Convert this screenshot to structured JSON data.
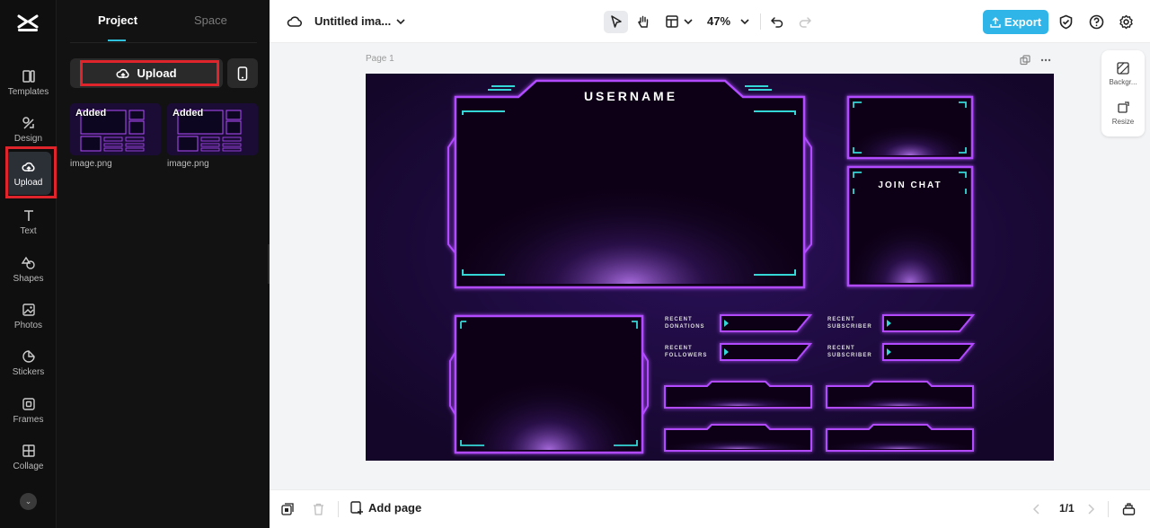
{
  "rail": {
    "items": [
      {
        "label": "Templates",
        "icon": "templates-icon"
      },
      {
        "label": "Design",
        "icon": "design-icon"
      },
      {
        "label": "Upload",
        "icon": "upload-cloud-icon",
        "active": true
      },
      {
        "label": "Text",
        "icon": "text-icon"
      },
      {
        "label": "Shapes",
        "icon": "shapes-icon"
      },
      {
        "label": "Photos",
        "icon": "photos-icon"
      },
      {
        "label": "Stickers",
        "icon": "stickers-icon"
      },
      {
        "label": "Frames",
        "icon": "frames-icon"
      },
      {
        "label": "Collage",
        "icon": "collage-icon"
      }
    ]
  },
  "panel": {
    "tabs": [
      {
        "label": "Project"
      },
      {
        "label": "Space"
      }
    ],
    "upload_label": "Upload",
    "assets": [
      {
        "badge": "Added",
        "name": "image.png"
      },
      {
        "badge": "Added",
        "name": "image.png"
      }
    ]
  },
  "topbar": {
    "title": "Untitled ima...",
    "zoom": "47%",
    "export_label": "Export"
  },
  "canvas": {
    "page_label": "Page 1",
    "overlay": {
      "username": "USERNAME",
      "join_chat": "JOIN CHAT",
      "recent_donations": [
        "RECENT",
        "DONATIONS"
      ],
      "recent_followers": [
        "RECENT",
        "FOLLOWERS"
      ],
      "recent_subscriber_1": [
        "RECENT",
        "SUBSCRIBER"
      ],
      "recent_subscriber_2": [
        "RECENT",
        "SUBSCRIBER"
      ]
    }
  },
  "right_tools": {
    "background_label": "Backgr...",
    "resize_label": "Resize"
  },
  "bottombar": {
    "add_page_label": "Add page",
    "page_count": "1/1"
  },
  "colors": {
    "accent": "#2fb5e8",
    "highlight_red": "#e0242c",
    "neon_purple": "#b24cff",
    "neon_teal": "#35d6d6"
  }
}
